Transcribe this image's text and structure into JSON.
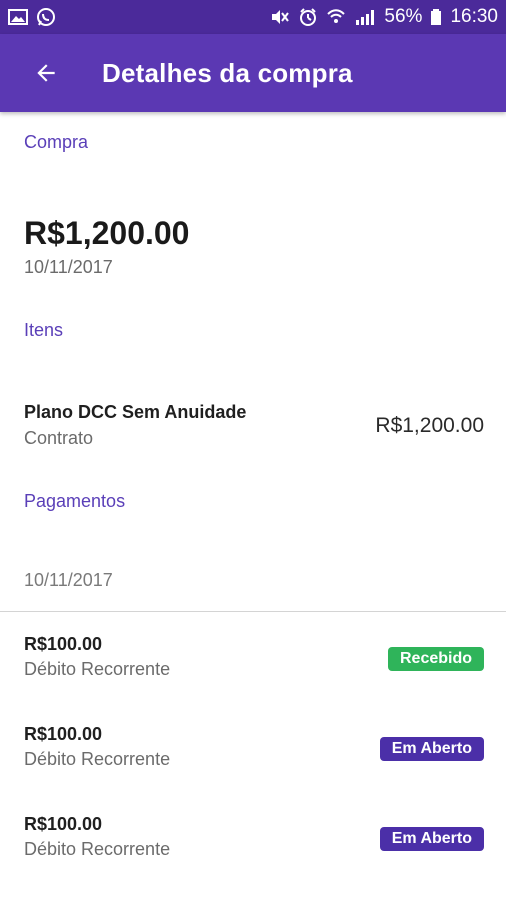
{
  "status_bar": {
    "icons_left": [
      "image-icon",
      "whatsapp-icon"
    ],
    "icons_right": [
      "mute-icon",
      "alarm-icon",
      "wifi-icon",
      "signal-icon",
      "battery-icon"
    ],
    "battery_text": "56%",
    "time": "16:30"
  },
  "app_bar": {
    "back_icon": "arrow-left-icon",
    "title": "Detalhes da compra"
  },
  "purchase": {
    "section_label": "Compra",
    "amount": "R$1,200.00",
    "date": "10/11/2017"
  },
  "items": {
    "section_label": "Itens",
    "list": [
      {
        "name": "Plano DCC Sem Anuidade",
        "type": "Contrato",
        "price": "R$1,200.00"
      }
    ]
  },
  "payments": {
    "section_label": "Pagamentos",
    "date": "10/11/2017",
    "list": [
      {
        "amount": "R$100.00",
        "method": "Débito Recorrente",
        "status": "Recebido"
      },
      {
        "amount": "R$100.00",
        "method": "Débito Recorrente",
        "status": "Em Aberto"
      },
      {
        "amount": "R$100.00",
        "method": "Débito Recorrente",
        "status": "Em Aberto"
      }
    ]
  },
  "colors": {
    "status_bar": "#4b2a9a",
    "app_bar": "#5b38b3",
    "section_label": "#5a3fb8",
    "badge_received": "#2fb45a",
    "badge_open": "#4b2fa8"
  }
}
